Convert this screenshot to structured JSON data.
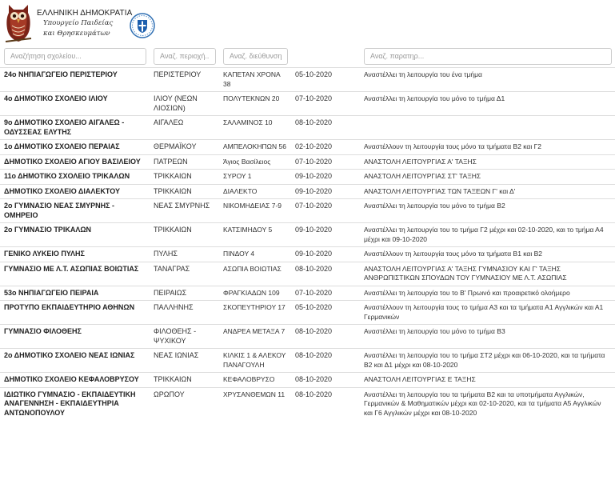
{
  "header": {
    "ministry_line1": "ΕΛΛΗΝΙΚΗ ΔΗΜΟΚΡΑΤΙΑ",
    "ministry_line2": "Υπουργείο Παιδείας",
    "ministry_line3": "και Θρησκευμάτων",
    "logo_icon": "owl-logo-icon",
    "seal_icon": "greek-coat-of-arms-icon"
  },
  "filters": {
    "school_placeholder": "Αναζήτηση σχολείου...",
    "area_placeholder": "Αναζ. περιοχή...",
    "address_placeholder": "Αναζ. διεύθυνση",
    "notes_placeholder": "Αναζ. παρατηρ..."
  },
  "rows": [
    {
      "name": "24ο ΝΗΠΙΑΓΩΓΕΙΟ ΠΕΡΙΣΤΕΡΙΟΥ",
      "area": "ΠΕΡΙΣΤΕΡΙΟΥ",
      "address": "ΚΑΠΕΤΑΝ ΧΡΟΝΑ 38",
      "date": "05-10-2020",
      "note": "Αναστέλλει τη λειτουργία του ένα τμήμα"
    },
    {
      "name": "4ο ΔΗΜΟΤΙΚΟ ΣΧΟΛΕΙΟ ΙΛΙΟΥ",
      "area": "ΙΛΙΟΥ (ΝΕΩΝ ΛΙΟΣΙΩΝ)",
      "address": "ΠΟΛΥΤΕΚΝΩΝ 20",
      "date": "07-10-2020",
      "note": "Αναστέλλει τη λειτουργία του μόνο το τμήμα Δ1"
    },
    {
      "name": "9ο ΔΗΜΟΤΙΚΟ ΣΧΟΛΕΙΟ ΑΙΓΑΛΕΩ - ΟΔΥΣΣΕΑΣ ΕΛΥΤΗΣ",
      "area": "ΑΙΓΑΛΕΩ",
      "address": "ΣΑΛΑΜΙΝΟΣ 10",
      "date": "08-10-2020",
      "note": ""
    },
    {
      "name": "1ο ΔΗΜΟΤΙΚΟ ΣΧΟΛΕΙΟ ΠΕΡΑΙΑΣ",
      "area": "ΘΕΡΜΑΪΚΟΥ",
      "address": "ΑΜΠΕΛΟΚΗΠΩΝ 56",
      "date": "02-10-2020",
      "note": "Αναστέλλουν τη λειτουργία τους μόνο τα τμήματα Β2 και Γ2"
    },
    {
      "name": "ΔΗΜΟΤΙΚΟ ΣΧΟΛΕΙΟ ΑΓΙΟΥ ΒΑΣΙΛΕΙΟΥ",
      "area": "ΠΑΤΡΕΩΝ",
      "address": "Άγιος Βασίλειος",
      "date": "07-10-2020",
      "note": "ΑΝΑΣΤΟΛΗ ΛΕΙΤΟΥΡΓΙΑΣ Α' ΤΑΞΗΣ"
    },
    {
      "name": "11ο ΔΗΜΟΤΙΚΟ ΣΧΟΛΕΙΟ ΤΡΙΚΑΛΩΝ",
      "area": "ΤΡΙΚΚΑΙΩΝ",
      "address": "ΣΥΡΟΥ 1",
      "date": "09-10-2020",
      "note": "ΑΝΑΣΤΟΛΗ ΛΕΙΤΟΥΡΓΙΑΣ ΣΤ' ΤΑΞΗΣ"
    },
    {
      "name": "ΔΗΜΟΤΙΚΟ ΣΧΟΛΕΙΟ ΔΙΑΛΕΚΤΟΥ",
      "area": "ΤΡΙΚΚΑΙΩΝ",
      "address": "ΔΙΑΛΕΚΤΟ",
      "date": "09-10-2020",
      "note": "ΑΝΑΣΤΟΛΗ ΛΕΙΤΟΥΡΓΙΑΣ ΤΩΝ ΤΑΞΕΩΝ Γ' και Δ'"
    },
    {
      "name": "2ο ΓΥΜΝΑΣΙΟ ΝΕΑΣ ΣΜΥΡΝΗΣ - ΟΜΗΡΕΙΟ",
      "area": "ΝΕΑΣ ΣΜΥΡΝΗΣ",
      "address": "ΝΙΚΟΜΗΔΕΙΑΣ 7-9",
      "date": "07-10-2020",
      "note": "Αναστέλλει τη λειτουργία του μόνο το τμήμα Β2"
    },
    {
      "name": "2ο ΓΥΜΝΑΣΙΟ ΤΡΙΚΑΛΩΝ",
      "area": "ΤΡΙΚΚΑΙΩΝ",
      "address": "ΚΑΤΣΙΜΗΔΟΥ 5",
      "date": "09-10-2020",
      "note": "Αναστέλλει τη λειτουργία του το τμήμα Γ2 μέχρι και 02-10-2020, και το τμήμα Α4 μέχρι και 09-10-2020"
    },
    {
      "name": "ΓΕΝΙΚΟ ΛΥΚΕΙΟ ΠΥΛΗΣ",
      "area": "ΠΥΛΗΣ",
      "address": "ΠΙΝΔΟΥ 4",
      "date": "09-10-2020",
      "note": "Αναστέλλουν τη λειτουργία τους μόνο τα τμήματα Β1 και Β2"
    },
    {
      "name": "ΓΥΜΝΑΣΙΟ ΜΕ Λ.Τ. ΑΣΩΠΙΑΣ ΒΟΙΩΤΙΑΣ",
      "area": "ΤΑΝΑΓΡΑΣ",
      "address": "ΑΣΩΠΙΑ ΒΟΙΩΤΙΑΣ",
      "date": "08-10-2020",
      "note": "ΑΝΑΣΤΟΛΗ ΛΕΙΤΟΥΡΓΙΑΣ Α' ΤΑΞΗΣ ΓΥΜΝΑΣΙΟΥ ΚΑΙ Γ' ΤΑΞΗΣ ΑΝΘΡΩΠΙΣΤΙΚΩΝ ΣΠΟΥΔΩΝ ΤΟΥ ΓΥΜΝΑΣΙΟΥ ΜΕ Λ.Τ. ΑΣΩΠΙΑΣ"
    },
    {
      "name": "53ο ΝΗΠΙΑΓΩΓΕΙΟ ΠΕΙΡΑΙΑ",
      "area": "ΠΕΙΡΑΙΩΣ",
      "address": "ΦΡΑΓΚΙΑΔΩΝ 109",
      "date": "07-10-2020",
      "note": "Αναστέλλει τη λειτουργία του το Β' Πρωινό και προαιρετικό ολοήμερο"
    },
    {
      "name": "ΠΡΟΤΥΠΟ ΕΚΠΑΙΔΕΥΤΗΡΙΟ ΑΘΗΝΩΝ",
      "area": "ΠΑΛΛΗΝΗΣ",
      "address": "ΣΚΟΠΕΥΤΗΡΙΟΥ 17",
      "date": "05-10-2020",
      "note": "Αναστέλλουν τη λειτουργία τους το τμήμα Α3 και τα τμήματα Α1 Αγγλικών και Α1 Γερμανικών"
    },
    {
      "name": "ΓΥΜΝΑΣΙΟ ΦΙΛΟΘΕΗΣ",
      "area": "ΦΙΛΟΘΕΗΣ - ΨΥΧΙΚΟΥ",
      "address": "ΑΝΔΡΕΑ ΜΕΤΑΞΑ 7",
      "date": "08-10-2020",
      "note": "Αναστέλλει τη λειτουργία του μόνο το τμήμα Β3"
    },
    {
      "name": "2ο ΔΗΜΟΤΙΚΟ ΣΧΟΛΕΙΟ ΝΕΑΣ ΙΩΝΙΑΣ",
      "area": "ΝΕΑΣ ΙΩΝΙΑΣ",
      "address": "ΚΙΛΚΙΣ 1 & ΑΛΕΚΟΥ ΠΑΝΑΓΟΥΛΗ",
      "date": "08-10-2020",
      "note": "Αναστέλλει τη λειτουργία του το τμήμα ΣΤ2 μέχρι και 06-10-2020, και τα τμήματα Β2 και Δ1 μέχρι και 08-10-2020"
    },
    {
      "name": "ΔΗΜΟΤΙΚΟ ΣΧΟΛΕΙΟ ΚΕΦΑΛΟΒΡΥΣΟΥ",
      "area": "ΤΡΙΚΚΑΙΩΝ",
      "address": "ΚΕΦΑΛΟΒΡΥΣΟ",
      "date": "08-10-2020",
      "note": "ΑΝΑΣΤΟΛΗ ΛΕΙΤΟΥΡΓΙΑΣ Ε ΤΑΞΗΣ"
    },
    {
      "name": "ΙΔΙΩΤΙΚΟ ΓΥΜΝΑΣΙΟ - ΕΚΠΑΙΔΕΥΤΙΚΗ ΑΝΑΓΕΝΝΗΣΗ - ΕΚΠΑΙΔΕΥΤΗΡΙΑ ΑΝΤΩΝΟΠΟΥΛΟΥ",
      "area": "ΩΡΩΠΟΥ",
      "address": "ΧΡΥΣΑΝΘΕΜΩΝ 11",
      "date": "08-10-2020",
      "note": "Αναστέλλει τη λειτουργία του τα τμήματα Β2 και τα υποτμήματα Αγγλικών, Γερμανικών & Μαθηματικών μέχρι και 02-10-2020, και τα τμήματα Α5 Αγγλικών και Γ6 Αγγλικών μέχρι και 08-10-2020"
    }
  ]
}
